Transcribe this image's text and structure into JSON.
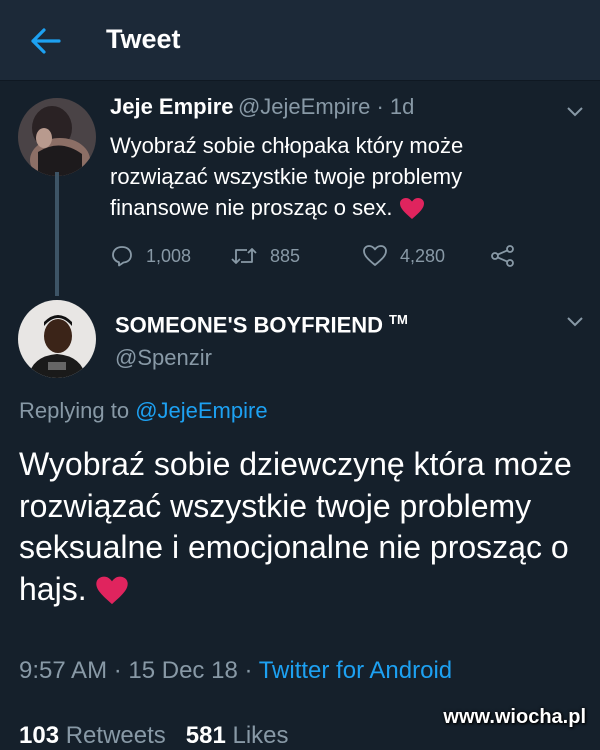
{
  "header": {
    "title": "Tweet"
  },
  "parent_tweet": {
    "name": "Jeje Empire",
    "handle": "@JejeEmpire",
    "sep": " · ",
    "time": "1d",
    "text": "Wyobraź sobie chłopaka który może rozwiązać wszystkie twoje problemy finansowe nie prosząc o sex.",
    "replies": "1,008",
    "retweets": "885",
    "likes": "4,280"
  },
  "reply_tweet": {
    "name": "SOMEONE'S BOYFRIEND",
    "tm": "TM",
    "handle": "@Spenzir",
    "replying_prefix": "Replying to ",
    "replying_to": "@JejeEmpire",
    "text": "Wyobraź sobie dziewczynę która może rozwiązać wszystkie twoje problemy seksualne i emocjonalne nie prosząc o hajs.",
    "time": "9:57 AM",
    "sep": " · ",
    "date": "15 Dec 18",
    "source": "Twitter for Android",
    "retweets_count": "103",
    "retweets_label": "Retweets",
    "likes_count": "581",
    "likes_label": "Likes"
  },
  "watermark": "www.wiocha.pl",
  "colors": {
    "background": "#15202b",
    "header": "#1c2938",
    "accent": "#1da1f2",
    "muted": "#8899a6",
    "heart": "#e0245e"
  },
  "icons": [
    "back-arrow-icon",
    "chevron-down-icon",
    "reply-icon",
    "retweet-icon",
    "like-icon",
    "share-icon",
    "heart-emoji-icon"
  ]
}
